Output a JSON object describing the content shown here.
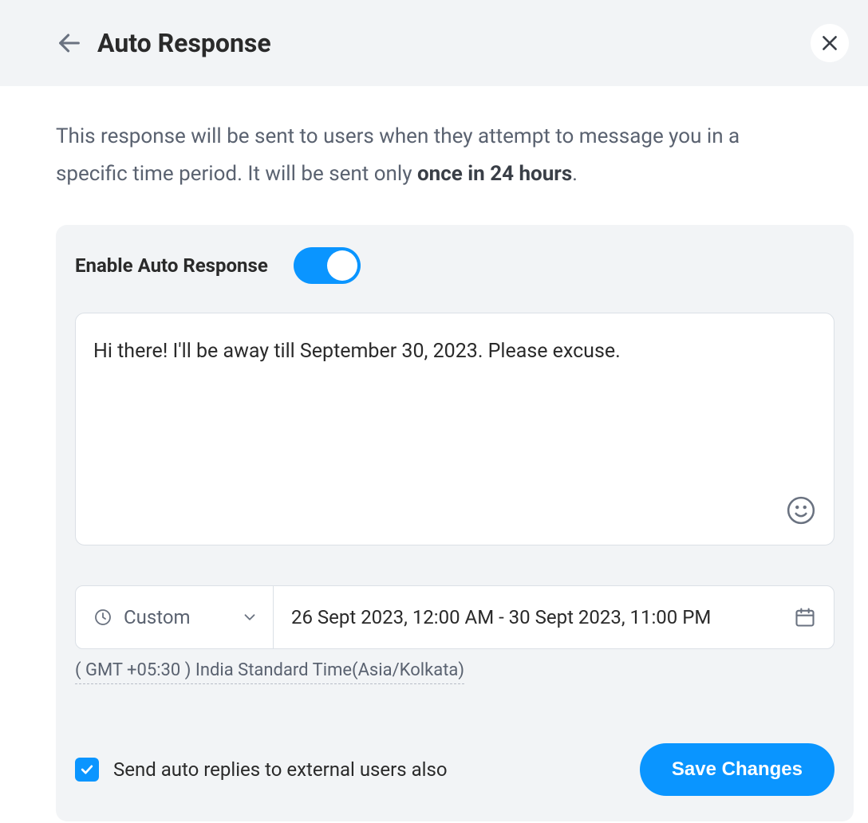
{
  "header": {
    "title": "Auto Response"
  },
  "description": {
    "prefix": "This response will be sent to users when they attempt to message you in a specific time period. It will be sent only ",
    "bold": "once in 24 hours",
    "suffix": "."
  },
  "enable": {
    "label": "Enable Auto Response",
    "on": true
  },
  "message": {
    "text": "Hi there! I'll be away till September 30, 2023. Please excuse."
  },
  "schedule": {
    "mode_label": "Custom",
    "range_text": "26 Sept 2023, 12:00 AM - 30 Sept 2023, 11:00 PM"
  },
  "timezone": {
    "text": "( GMT +05:30 ) India Standard Time(Asia/Kolkata)"
  },
  "external": {
    "label": "Send auto replies to external users also",
    "checked": true
  },
  "save": {
    "label": "Save Changes"
  }
}
